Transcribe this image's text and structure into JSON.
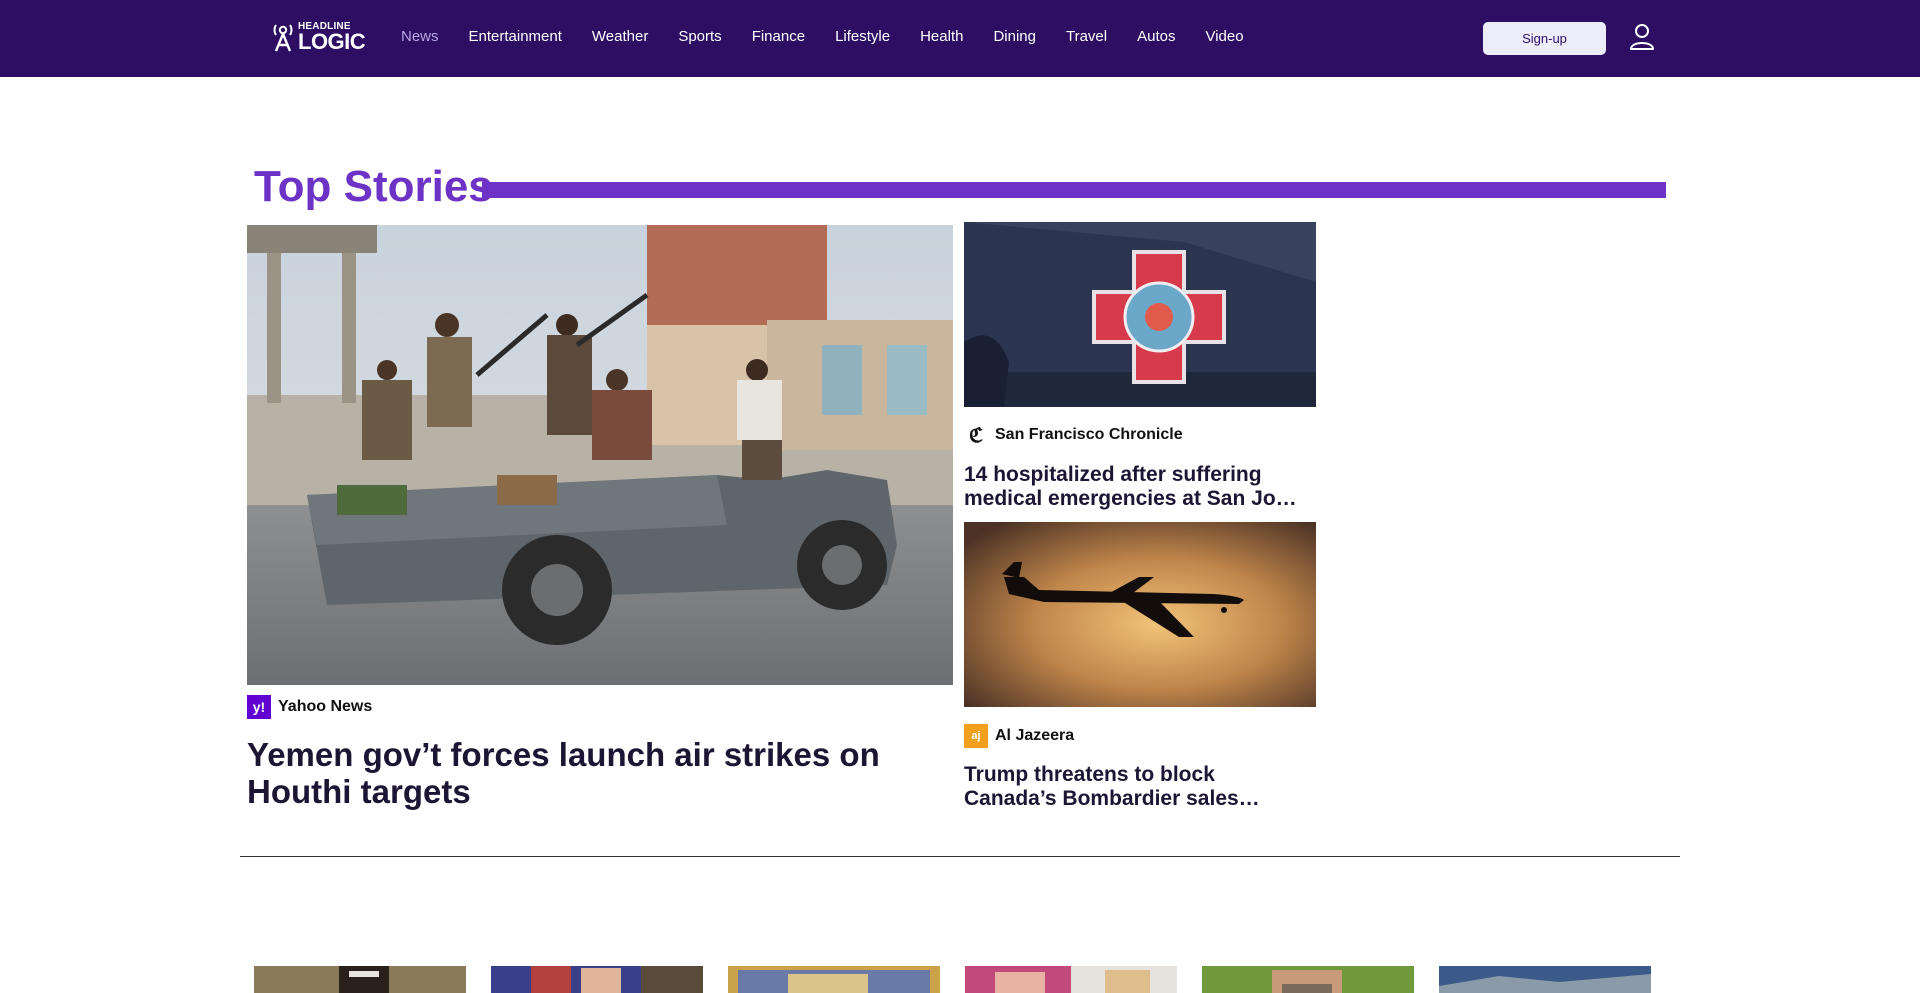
{
  "header": {
    "logo_small": "HEADLINE",
    "logo_big": "LOGIC",
    "nav": [
      {
        "label": "News",
        "active": true
      },
      {
        "label": "Entertainment",
        "active": false
      },
      {
        "label": "Weather",
        "active": false
      },
      {
        "label": "Sports",
        "active": false
      },
      {
        "label": "Finance",
        "active": false
      },
      {
        "label": "Lifestyle",
        "active": false
      },
      {
        "label": "Health",
        "active": false
      },
      {
        "label": "Dining",
        "active": false
      },
      {
        "label": "Travel",
        "active": false
      },
      {
        "label": "Autos",
        "active": false
      },
      {
        "label": "Video",
        "active": false
      }
    ],
    "signup_label": "Sign-up",
    "user_icon": "user-icon"
  },
  "top_stories": {
    "title": "Top Stories",
    "feature": {
      "source": "Yahoo News",
      "source_logo": "y!",
      "title": "Yemen gov’t forces launch air strikes on Houthi targets"
    },
    "side": [
      {
        "source": "San Francisco Chronicle",
        "source_logo": "ℭ",
        "title_line1": "14 hospitalized after suffering",
        "title_line2": "medical emergencies at San Jo…"
      },
      {
        "source": "Al Jazeera",
        "source_logo": "aj",
        "title_line1": "Trump threatens to block",
        "title_line2": "Canada’s Bombardier sales…"
      }
    ]
  },
  "colors": {
    "header_bg": "#2d0e63",
    "accent": "#6c33c6",
    "nav_active": "#b6a7e4",
    "yahoo_purple": "#6001d2",
    "aljazeera_gold": "#f0a01a"
  }
}
